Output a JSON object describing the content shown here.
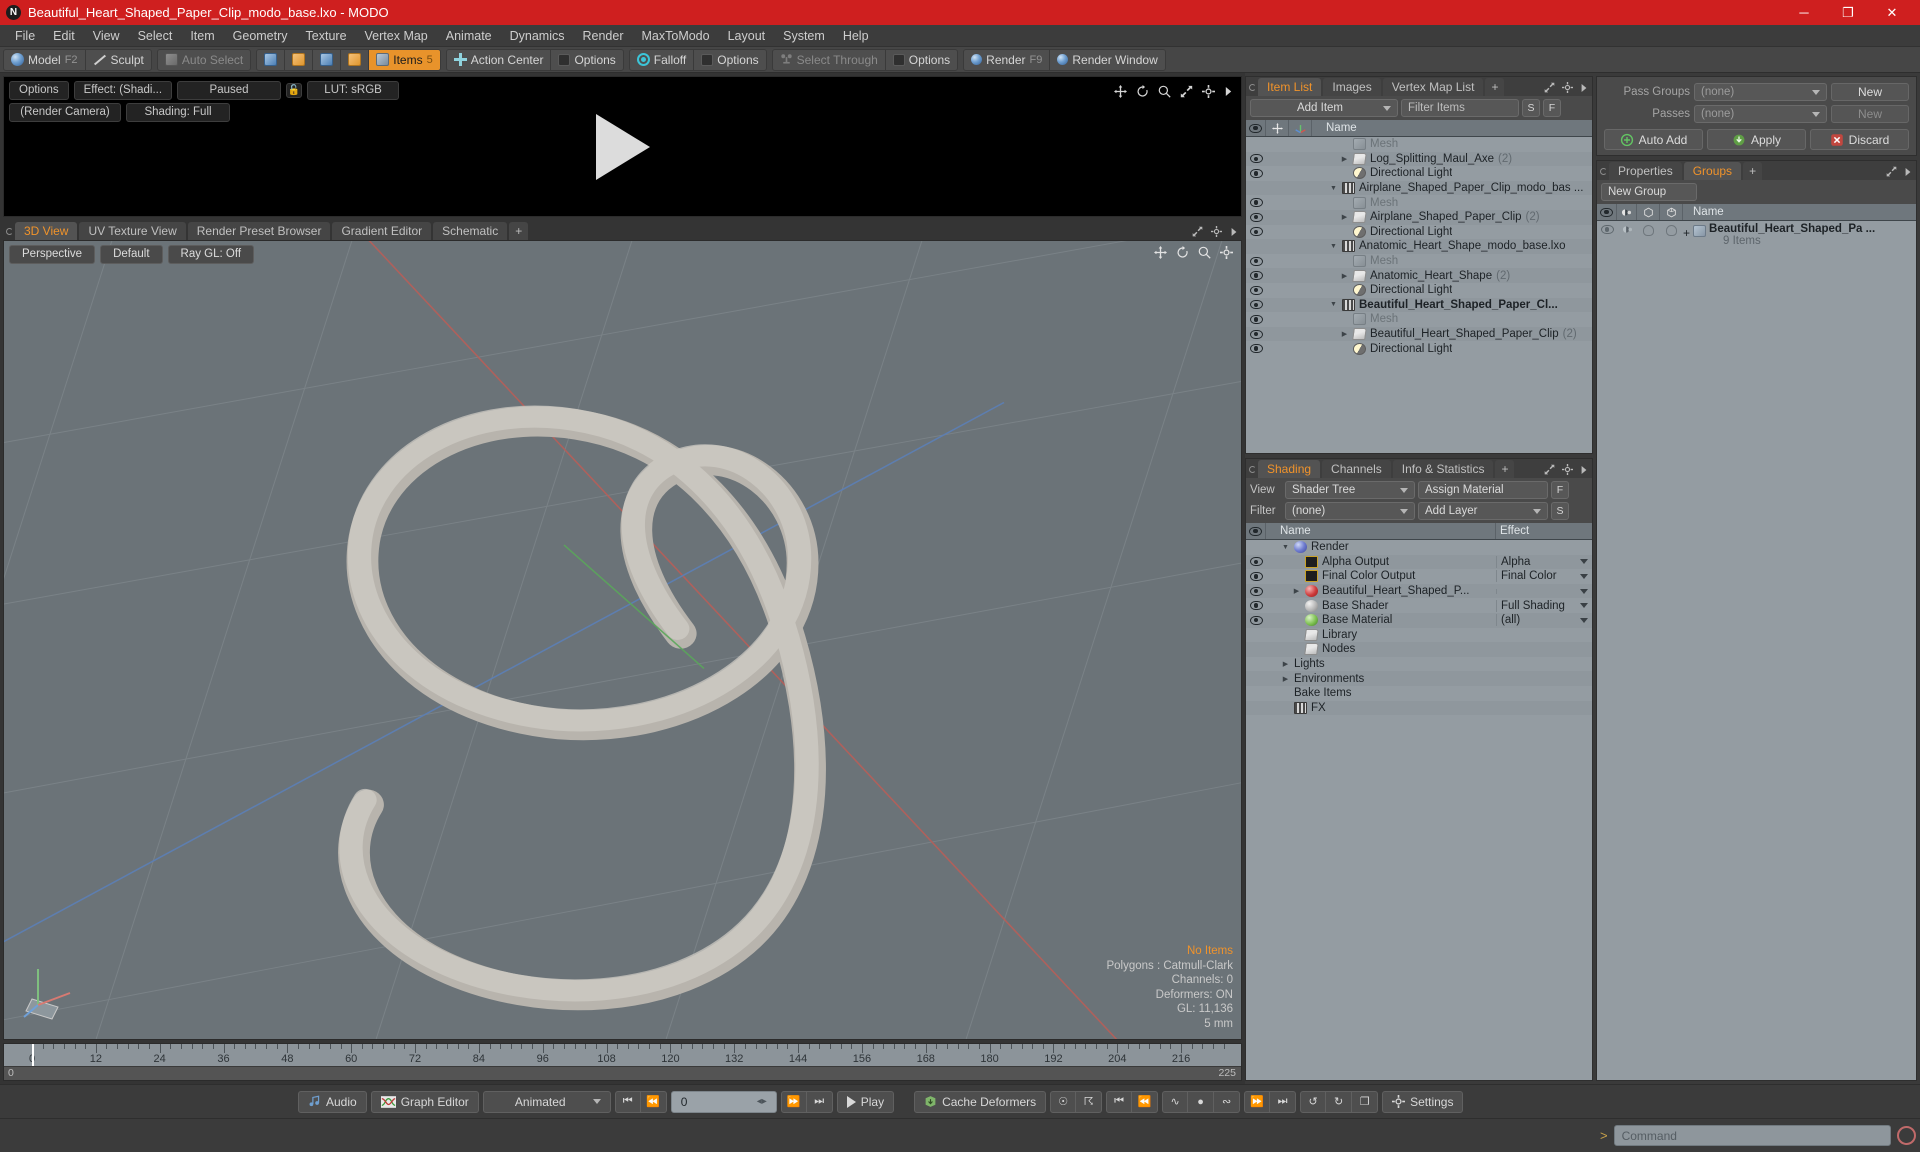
{
  "window": {
    "title": "Beautiful_Heart_Shaped_Paper_Clip_modo_base.lxo - MODO",
    "logo": "N",
    "minimize": "─",
    "maximize": "❐",
    "close": "✕"
  },
  "menubar": {
    "items": [
      "File",
      "Edit",
      "View",
      "Select",
      "Item",
      "Geometry",
      "Texture",
      "Vertex Map",
      "Animate",
      "Dynamics",
      "Render",
      "MaxToModo",
      "Layout",
      "System",
      "Help"
    ]
  },
  "modebar": {
    "model": "Model",
    "model_key": "F2",
    "sculpt": "Sculpt",
    "auto_select": "Auto Select",
    "items": "Items",
    "items_key": "5",
    "action_center": "Action Center",
    "options1": "Options",
    "falloff": "Falloff",
    "options2": "Options",
    "select_through": "Select Through",
    "options3": "Options",
    "render": "Render",
    "render_key": "F9",
    "render_window": "Render Window"
  },
  "preview": {
    "options": "Options",
    "effect": "Effect: (Shadi...",
    "paused": "Paused",
    "lut": "LUT: sRGB",
    "camera": "(Render Camera)",
    "shading": "Shading: Full",
    "icons": [
      "move-icon",
      "rotate-icon",
      "zoom-icon",
      "fit-icon",
      "gear-icon",
      "arrow-right-icon"
    ]
  },
  "viewport": {
    "tabs": [
      "3D View",
      "UV Texture View",
      "Render Preset Browser",
      "Gradient Editor",
      "Schematic"
    ],
    "active_tab": "3D View",
    "add_tab": "+",
    "projection": "Perspective",
    "style": "Default",
    "raygl": "Ray GL: Off",
    "stats": {
      "selection": "No Items",
      "polygons": "Polygons : Catmull-Clark",
      "channels": "Channels: 0",
      "deformers": "Deformers: ON",
      "gl": "GL: 11,136",
      "scale": "5 mm"
    }
  },
  "timeline": {
    "labels": [
      "0",
      "12",
      "24",
      "36",
      "48",
      "60",
      "72",
      "84",
      "96",
      "108",
      "120",
      "132",
      "144",
      "156",
      "168",
      "180",
      "192",
      "204",
      "216"
    ],
    "range_start": "0",
    "range_end": "225",
    "playhead": "0"
  },
  "item_list": {
    "tabs": [
      "Item List",
      "Images",
      "Vertex Map List"
    ],
    "active_tab": "Item List",
    "add_tab": "+",
    "add_item": "Add Item",
    "filter_placeholder": "Filter Items",
    "btn_s": "S",
    "btn_f": "F",
    "col_name": "Name",
    "rows": [
      {
        "label": "Mesh",
        "count": "",
        "icon": "mesh-icon",
        "depth": 2,
        "twist": "",
        "dim": true,
        "bold": false,
        "eye": false
      },
      {
        "label": "Log_Splitting_Maul_Axe",
        "count": "(2)",
        "icon": "folder-icon",
        "depth": 2,
        "twist": "▶",
        "dim": false,
        "bold": false,
        "eye": true
      },
      {
        "label": "Directional Light",
        "count": "",
        "icon": "light-icon",
        "depth": 2,
        "twist": "",
        "dim": false,
        "bold": false,
        "eye": true
      },
      {
        "label": "Airplane_Shaped_Paper_Clip_modo_bas ...",
        "count": "",
        "icon": "film-icon",
        "depth": 1,
        "twist": "▼",
        "dim": false,
        "bold": false,
        "eye": false
      },
      {
        "label": "Mesh",
        "count": "",
        "icon": "mesh-icon",
        "depth": 2,
        "twist": "",
        "dim": true,
        "bold": false,
        "eye": true
      },
      {
        "label": "Airplane_Shaped_Paper_Clip",
        "count": "(2)",
        "icon": "folder-icon",
        "depth": 2,
        "twist": "▶",
        "dim": false,
        "bold": false,
        "eye": true
      },
      {
        "label": "Directional Light",
        "count": "",
        "icon": "light-icon",
        "depth": 2,
        "twist": "",
        "dim": false,
        "bold": false,
        "eye": true
      },
      {
        "label": "Anatomic_Heart_Shape_modo_base.lxo",
        "count": "",
        "icon": "film-icon",
        "depth": 1,
        "twist": "▼",
        "dim": false,
        "bold": false,
        "eye": false
      },
      {
        "label": "Mesh",
        "count": "",
        "icon": "mesh-icon",
        "depth": 2,
        "twist": "",
        "dim": true,
        "bold": false,
        "eye": true
      },
      {
        "label": "Anatomic_Heart_Shape",
        "count": "(2)",
        "icon": "folder-icon",
        "depth": 2,
        "twist": "▶",
        "dim": false,
        "bold": false,
        "eye": true
      },
      {
        "label": "Directional Light",
        "count": "",
        "icon": "light-icon",
        "depth": 2,
        "twist": "",
        "dim": false,
        "bold": false,
        "eye": true
      },
      {
        "label": "Beautiful_Heart_Shaped_Paper_Cl...",
        "count": "",
        "icon": "film-icon",
        "depth": 1,
        "twist": "▼",
        "dim": false,
        "bold": true,
        "eye": true
      },
      {
        "label": "Mesh",
        "count": "",
        "icon": "mesh-icon",
        "depth": 2,
        "twist": "",
        "dim": true,
        "bold": false,
        "eye": true
      },
      {
        "label": "Beautiful_Heart_Shaped_Paper_Clip",
        "count": "(2)",
        "icon": "folder-icon",
        "depth": 2,
        "twist": "▶",
        "dim": false,
        "bold": false,
        "eye": true
      },
      {
        "label": "Directional Light",
        "count": "",
        "icon": "light-icon",
        "depth": 2,
        "twist": "",
        "dim": false,
        "bold": false,
        "eye": true
      }
    ]
  },
  "shading": {
    "tabs": [
      "Shading",
      "Channels",
      "Info & Statistics"
    ],
    "active_tab": "Shading",
    "add_tab": "+",
    "view_label": "View",
    "view_value": "Shader Tree",
    "assign_material": "Assign Material",
    "btn_f": "F",
    "filter_label": "Filter",
    "filter_value": "(none)",
    "add_layer": "Add Layer",
    "btn_s": "S",
    "col_name": "Name",
    "col_effect": "Effect",
    "rows": [
      {
        "label": "Render",
        "effect": "",
        "icon": "globe-icon",
        "depth": 1,
        "twist": "▼",
        "eye": false,
        "dd": false
      },
      {
        "label": "Alpha Output",
        "effect": "Alpha",
        "icon": "image-icon",
        "depth": 2,
        "twist": "",
        "eye": true,
        "dd": true
      },
      {
        "label": "Final Color Output",
        "effect": "Final Color",
        "icon": "image-icon",
        "depth": 2,
        "twist": "",
        "eye": true,
        "dd": true
      },
      {
        "label": "Beautiful_Heart_Shaped_P...",
        "effect": "",
        "icon": "red-sphere-icon",
        "depth": 2,
        "twist": "▶",
        "eye": true,
        "dd": true
      },
      {
        "label": "Base Shader",
        "effect": "Full Shading",
        "icon": "gray-sphere-icon",
        "depth": 2,
        "twist": "",
        "eye": true,
        "dd": true
      },
      {
        "label": "Base Material",
        "effect": "(all)",
        "icon": "green-sphere-icon",
        "depth": 2,
        "twist": "",
        "eye": true,
        "dd": true
      },
      {
        "label": "Library",
        "effect": "",
        "icon": "folder-icon",
        "depth": 2,
        "twist": "",
        "eye": false,
        "dd": false
      },
      {
        "label": "Nodes",
        "effect": "",
        "icon": "folder-icon",
        "depth": 2,
        "twist": "",
        "eye": false,
        "dd": false
      },
      {
        "label": "Lights",
        "effect": "",
        "icon": "none",
        "depth": 1,
        "twist": "▶",
        "eye": false,
        "dd": false
      },
      {
        "label": "Environments",
        "effect": "",
        "icon": "none",
        "depth": 1,
        "twist": "▶",
        "eye": false,
        "dd": false
      },
      {
        "label": "Bake Items",
        "effect": "",
        "icon": "none",
        "depth": 1,
        "twist": "",
        "eye": false,
        "dd": false
      },
      {
        "label": "FX",
        "effect": "",
        "icon": "film-icon",
        "depth": 1,
        "twist": "",
        "eye": false,
        "dd": false
      }
    ]
  },
  "passes": {
    "pass_groups_label": "Pass Groups",
    "pass_groups_value": "(none)",
    "pass_groups_new": "New",
    "passes_label": "Passes",
    "passes_value": "(none)",
    "passes_new": "New",
    "auto_add": "Auto Add",
    "apply": "Apply",
    "discard": "Discard"
  },
  "groups": {
    "tabs": [
      "Properties",
      "Groups"
    ],
    "active_tab": "Groups",
    "add_tab": "+",
    "new_group": "New Group",
    "col_name": "Name",
    "item_name": "Beautiful_Heart_Shaped_Pa ...",
    "item_sub": "9 Items",
    "expand": "+"
  },
  "bottombar": {
    "audio": "Audio",
    "graph_editor": "Graph Editor",
    "animated": "Animated",
    "frame_value": "0",
    "play": "Play",
    "cache_deformers": "Cache Deformers",
    "settings": "Settings",
    "command_placeholder": "Command",
    "command_prompt": ">"
  },
  "colors": {
    "title_bar": "#cf1f1f",
    "accent": "#f0932b",
    "viewport_bg": "#6b7378",
    "panel_bg": "#4a4a4a",
    "list_bg": "#949ca2"
  }
}
